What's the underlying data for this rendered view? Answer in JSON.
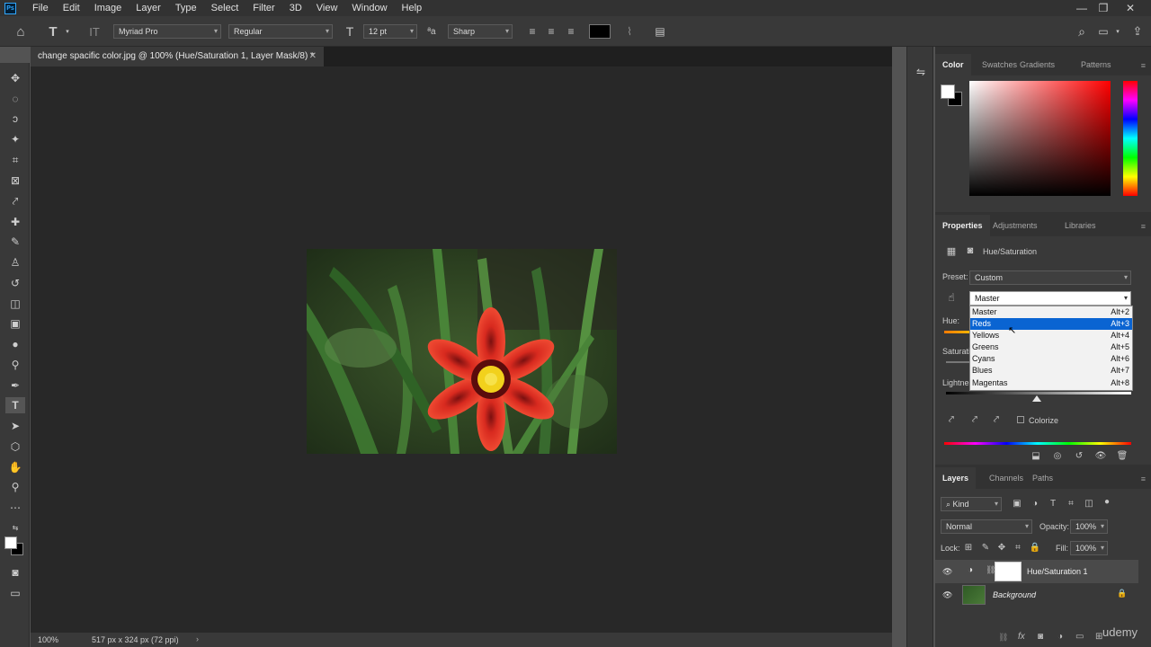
{
  "menubar": {
    "app_badge": "Ps",
    "items": [
      "File",
      "Edit",
      "Image",
      "Layer",
      "Type",
      "Select",
      "Filter",
      "3D",
      "View",
      "Window",
      "Help"
    ]
  },
  "options_bar": {
    "font_family": "Myriad Pro",
    "font_style": "Regular",
    "font_size": "12 pt",
    "antialias": "Sharp",
    "text_color": "#000000"
  },
  "document": {
    "tab_title": "change spacific color.jpg @ 100% (Hue/Saturation 1, Layer Mask/8) *",
    "zoom": "100%",
    "info": "517 px x 324 px (72 ppi)"
  },
  "color_panel": {
    "tabs": [
      "Color",
      "Swatches",
      "Gradients",
      "Patterns"
    ],
    "active_tab": "Color"
  },
  "properties_panel": {
    "tabs": [
      "Properties",
      "Adjustments",
      "Libraries"
    ],
    "active_tab": "Properties",
    "adjustment_name": "Hue/Saturation",
    "preset_label": "Preset:",
    "preset_value": "Custom",
    "range_value": "Master",
    "hue_label": "Hue:",
    "saturation_label": "Saturation:",
    "lightness_label": "Lightness:",
    "colorize_label": "Colorize",
    "range_options": [
      {
        "label": "Master",
        "shortcut": "Alt+2"
      },
      {
        "label": "Reds",
        "shortcut": "Alt+3"
      },
      {
        "label": "Yellows",
        "shortcut": "Alt+4"
      },
      {
        "label": "Greens",
        "shortcut": "Alt+5"
      },
      {
        "label": "Cyans",
        "shortcut": "Alt+6"
      },
      {
        "label": "Blues",
        "shortcut": "Alt+7"
      },
      {
        "label": "Magentas",
        "shortcut": "Alt+8"
      }
    ],
    "highlighted_option": "Reds"
  },
  "layers_panel": {
    "tabs": [
      "Layers",
      "Channels",
      "Paths"
    ],
    "active_tab": "Layers",
    "filter_kind": "Kind",
    "blend_mode": "Normal",
    "opacity_label": "Opacity:",
    "opacity_value": "100%",
    "lock_label": "Lock:",
    "fill_label": "Fill:",
    "fill_value": "100%",
    "layers": [
      {
        "name": "Hue/Saturation 1"
      },
      {
        "name": "Background"
      }
    ]
  },
  "watermark": "udemy",
  "colors": {
    "accent_selection": "#0a64d2",
    "canvas_bg": "#282828"
  }
}
